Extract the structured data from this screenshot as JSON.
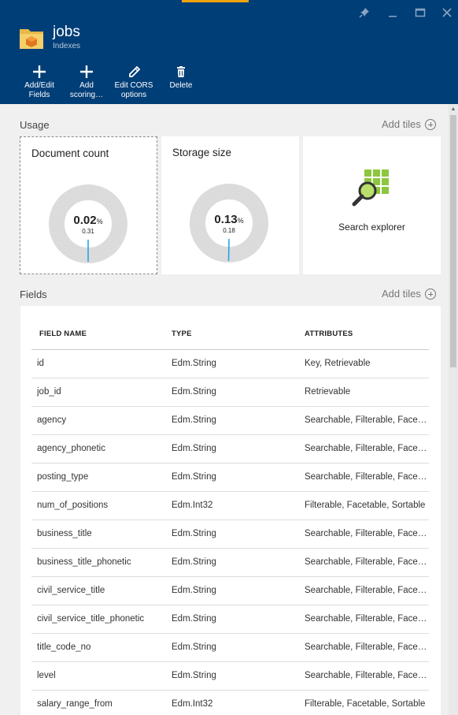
{
  "header": {
    "title": "jobs",
    "subtitle": "Indexes",
    "icon": "index-folder-icon",
    "accent_color": "#f0a30a",
    "background_color": "#003e77"
  },
  "window_controls": [
    "pin-icon",
    "minimize-icon",
    "maximize-icon",
    "close-icon"
  ],
  "commands": [
    {
      "label": "Add/Edit\nFields",
      "icon": "plus-icon"
    },
    {
      "label": "Add\nscoring…",
      "icon": "plus-icon"
    },
    {
      "label": "Edit CORS\noptions",
      "icon": "pencil-icon"
    },
    {
      "label": "Delete",
      "icon": "trash-icon"
    }
  ],
  "usage": {
    "section_title": "Usage",
    "add_tiles": "Add tiles",
    "tiles": [
      {
        "title": "Document count",
        "percent": "0.02",
        "percent_unit": "%",
        "value": "0.31",
        "fraction": 0.0002
      },
      {
        "title": "Storage size",
        "percent": "0.13",
        "percent_unit": "%",
        "value": "0.18",
        "fraction": 0.0013
      }
    ],
    "explorer": {
      "label": "Search explorer",
      "icon": "search-explorer-icon"
    }
  },
  "fields": {
    "section_title": "Fields",
    "add_tiles": "Add tiles",
    "columns": [
      "FIELD NAME",
      "TYPE",
      "ATTRIBUTES"
    ],
    "rows": [
      [
        "id",
        "Edm.String",
        "Key, Retrievable"
      ],
      [
        "job_id",
        "Edm.String",
        "Retrievable"
      ],
      [
        "agency",
        "Edm.String",
        "Searchable, Filterable, Facetable"
      ],
      [
        "agency_phonetic",
        "Edm.String",
        "Searchable, Filterable, Facetable"
      ],
      [
        "posting_type",
        "Edm.String",
        "Searchable, Filterable, Facetable"
      ],
      [
        "num_of_positions",
        "Edm.Int32",
        "Filterable, Facetable, Sortable"
      ],
      [
        "business_title",
        "Edm.String",
        "Searchable, Filterable, Facetable"
      ],
      [
        "business_title_phonetic",
        "Edm.String",
        "Searchable, Filterable, Facetable"
      ],
      [
        "civil_service_title",
        "Edm.String",
        "Searchable, Filterable, Facetable"
      ],
      [
        "civil_service_title_phonetic",
        "Edm.String",
        "Searchable, Filterable, Facetable"
      ],
      [
        "title_code_no",
        "Edm.String",
        "Searchable, Filterable, Facetable"
      ],
      [
        "level",
        "Edm.String",
        "Searchable, Filterable, Facetable"
      ],
      [
        "salary_range_from",
        "Edm.Int32",
        "Filterable, Facetable, Sortable"
      ]
    ]
  }
}
